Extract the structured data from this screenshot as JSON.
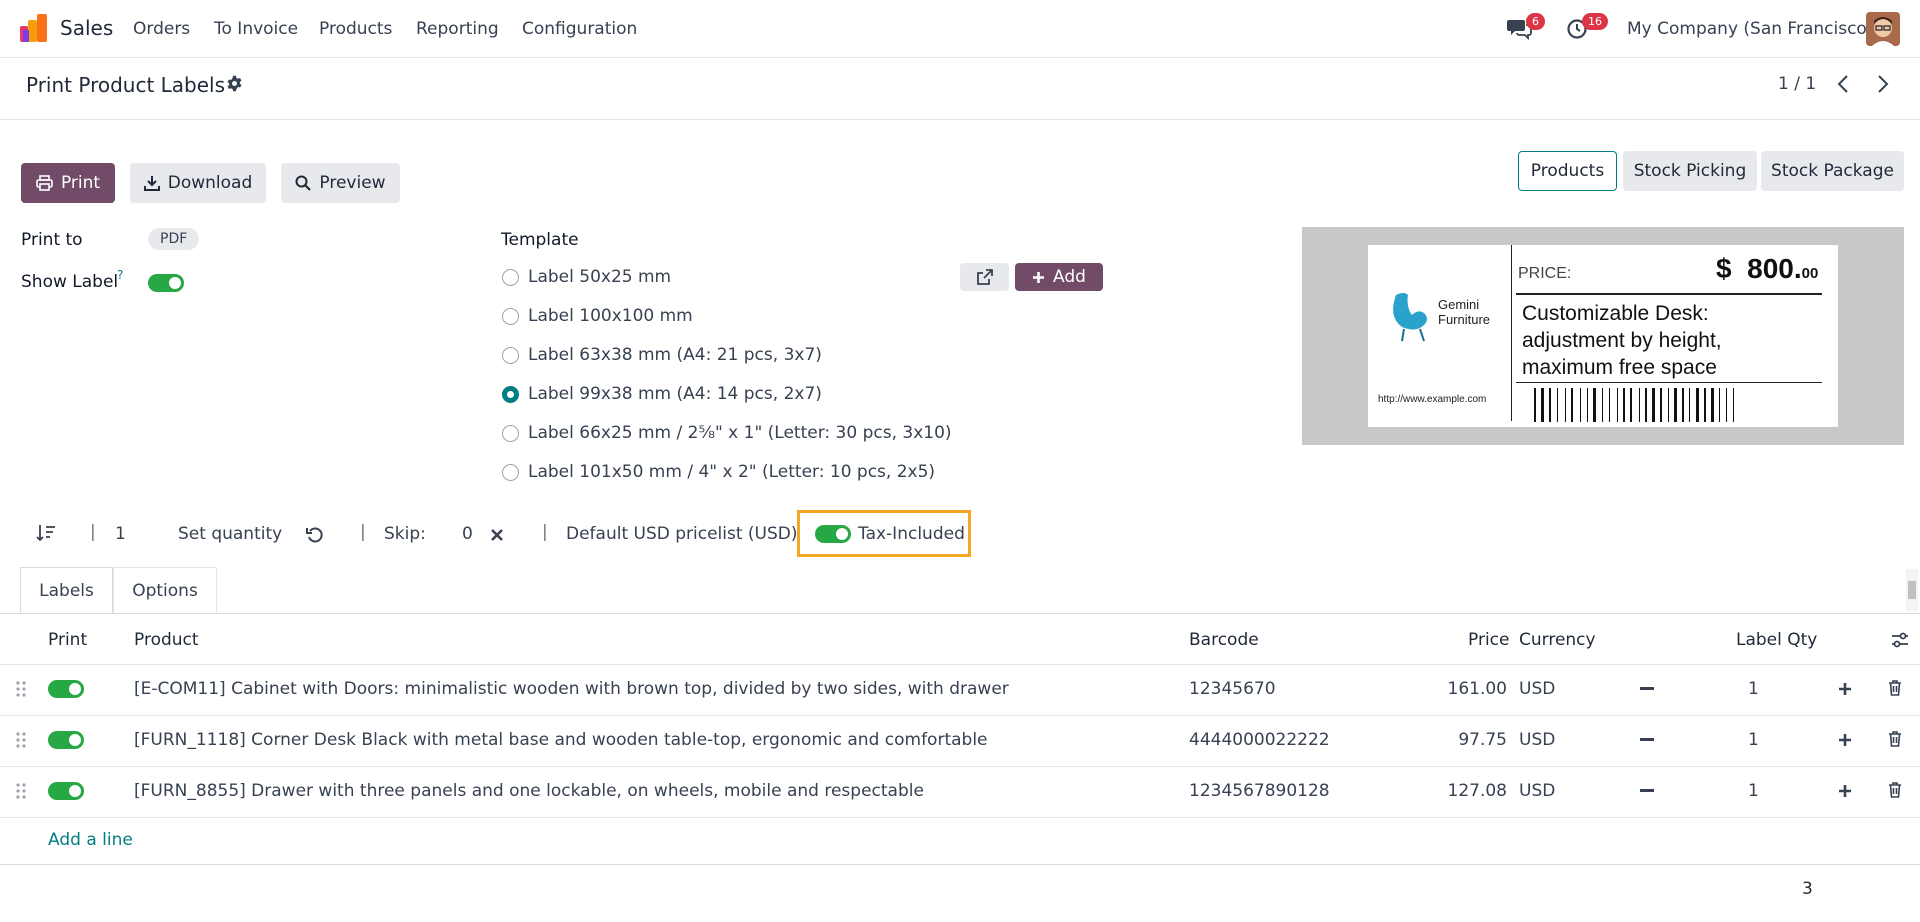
{
  "navbar": {
    "app_name": "Sales",
    "menu": [
      "Orders",
      "To Invoice",
      "Products",
      "Reporting",
      "Configuration"
    ],
    "messages_badge": "6",
    "activities_badge": "16",
    "company": "My Company (San Francisco)"
  },
  "control": {
    "breadcrumb": "Print Product Labels",
    "pager": "1 / 1"
  },
  "actions": {
    "print": "Print",
    "download": "Download",
    "preview": "Preview"
  },
  "source_tabs": [
    "Products",
    "Stock Picking",
    "Stock Package"
  ],
  "form": {
    "print_to_label": "Print to",
    "print_to_value": "PDF",
    "show_label_label": "Show Label",
    "show_label_help": "?",
    "template_label": "Template",
    "add_button": "Add",
    "templates": [
      {
        "label": "Label 50x25 mm",
        "checked": false
      },
      {
        "label": "Label 100x100 mm",
        "checked": false
      },
      {
        "label": "Label 63x38 mm (A4: 21 pcs, 3x7)",
        "checked": false
      },
      {
        "label": "Label 99x38 mm (A4: 14 pcs, 2x7)",
        "checked": true
      },
      {
        "label": "Label 66x25 mm / 2⅝\" x 1\" (Letter: 30 pcs, 3x10)",
        "checked": false
      },
      {
        "label": "Label 101x50 mm / 4\" x 2\" (Letter: 10 pcs, 2x5)",
        "checked": false
      }
    ]
  },
  "preview_label": {
    "brand_line1": "Gemini",
    "brand_line2": "Furniture",
    "url": "http://www.example.com",
    "price_caption": "PRICE:",
    "price_currency": "$",
    "price_main": "800.",
    "price_cents": "00",
    "product_line1": "Customizable Desk:",
    "product_line2": "adjustment by height,",
    "product_line3": "maximum free space"
  },
  "toolbar": {
    "quantity": "1",
    "set_quantity": "Set quantity",
    "skip_label": "Skip:",
    "skip_value": "0",
    "pricelist": "Default USD pricelist (USD)",
    "tax_included": "Tax-Included"
  },
  "notebook_tabs": [
    "Labels",
    "Options"
  ],
  "table": {
    "headers": {
      "print": "Print",
      "product": "Product",
      "barcode": "Barcode",
      "price": "Price",
      "currency": "Currency",
      "label_qty": "Label Qty"
    },
    "rows": [
      {
        "product": "[E-COM11] Cabinet with Doors: minimalistic wooden with brown top, divided by two sides, with drawer",
        "barcode": "12345670",
        "price": "161.00",
        "currency": "USD",
        "qty": "1"
      },
      {
        "product": "[FURN_1118] Corner Desk Black with metal base and wooden table-top, ergonomic and comfortable",
        "barcode": "4444000022222",
        "price": "97.75",
        "currency": "USD",
        "qty": "1"
      },
      {
        "product": "[FURN_8855] Drawer with three panels and one lockable, on wheels, mobile and respectable",
        "barcode": "1234567890128",
        "price": "127.08",
        "currency": "USD",
        "qty": "1"
      }
    ],
    "add_line": "Add a line",
    "total_qty": "3"
  },
  "colors": {
    "brand": "#714b67",
    "accent": "#017e84",
    "toggle_on": "#28a745",
    "highlight": "#f5a623",
    "badge": "#dc3545"
  }
}
